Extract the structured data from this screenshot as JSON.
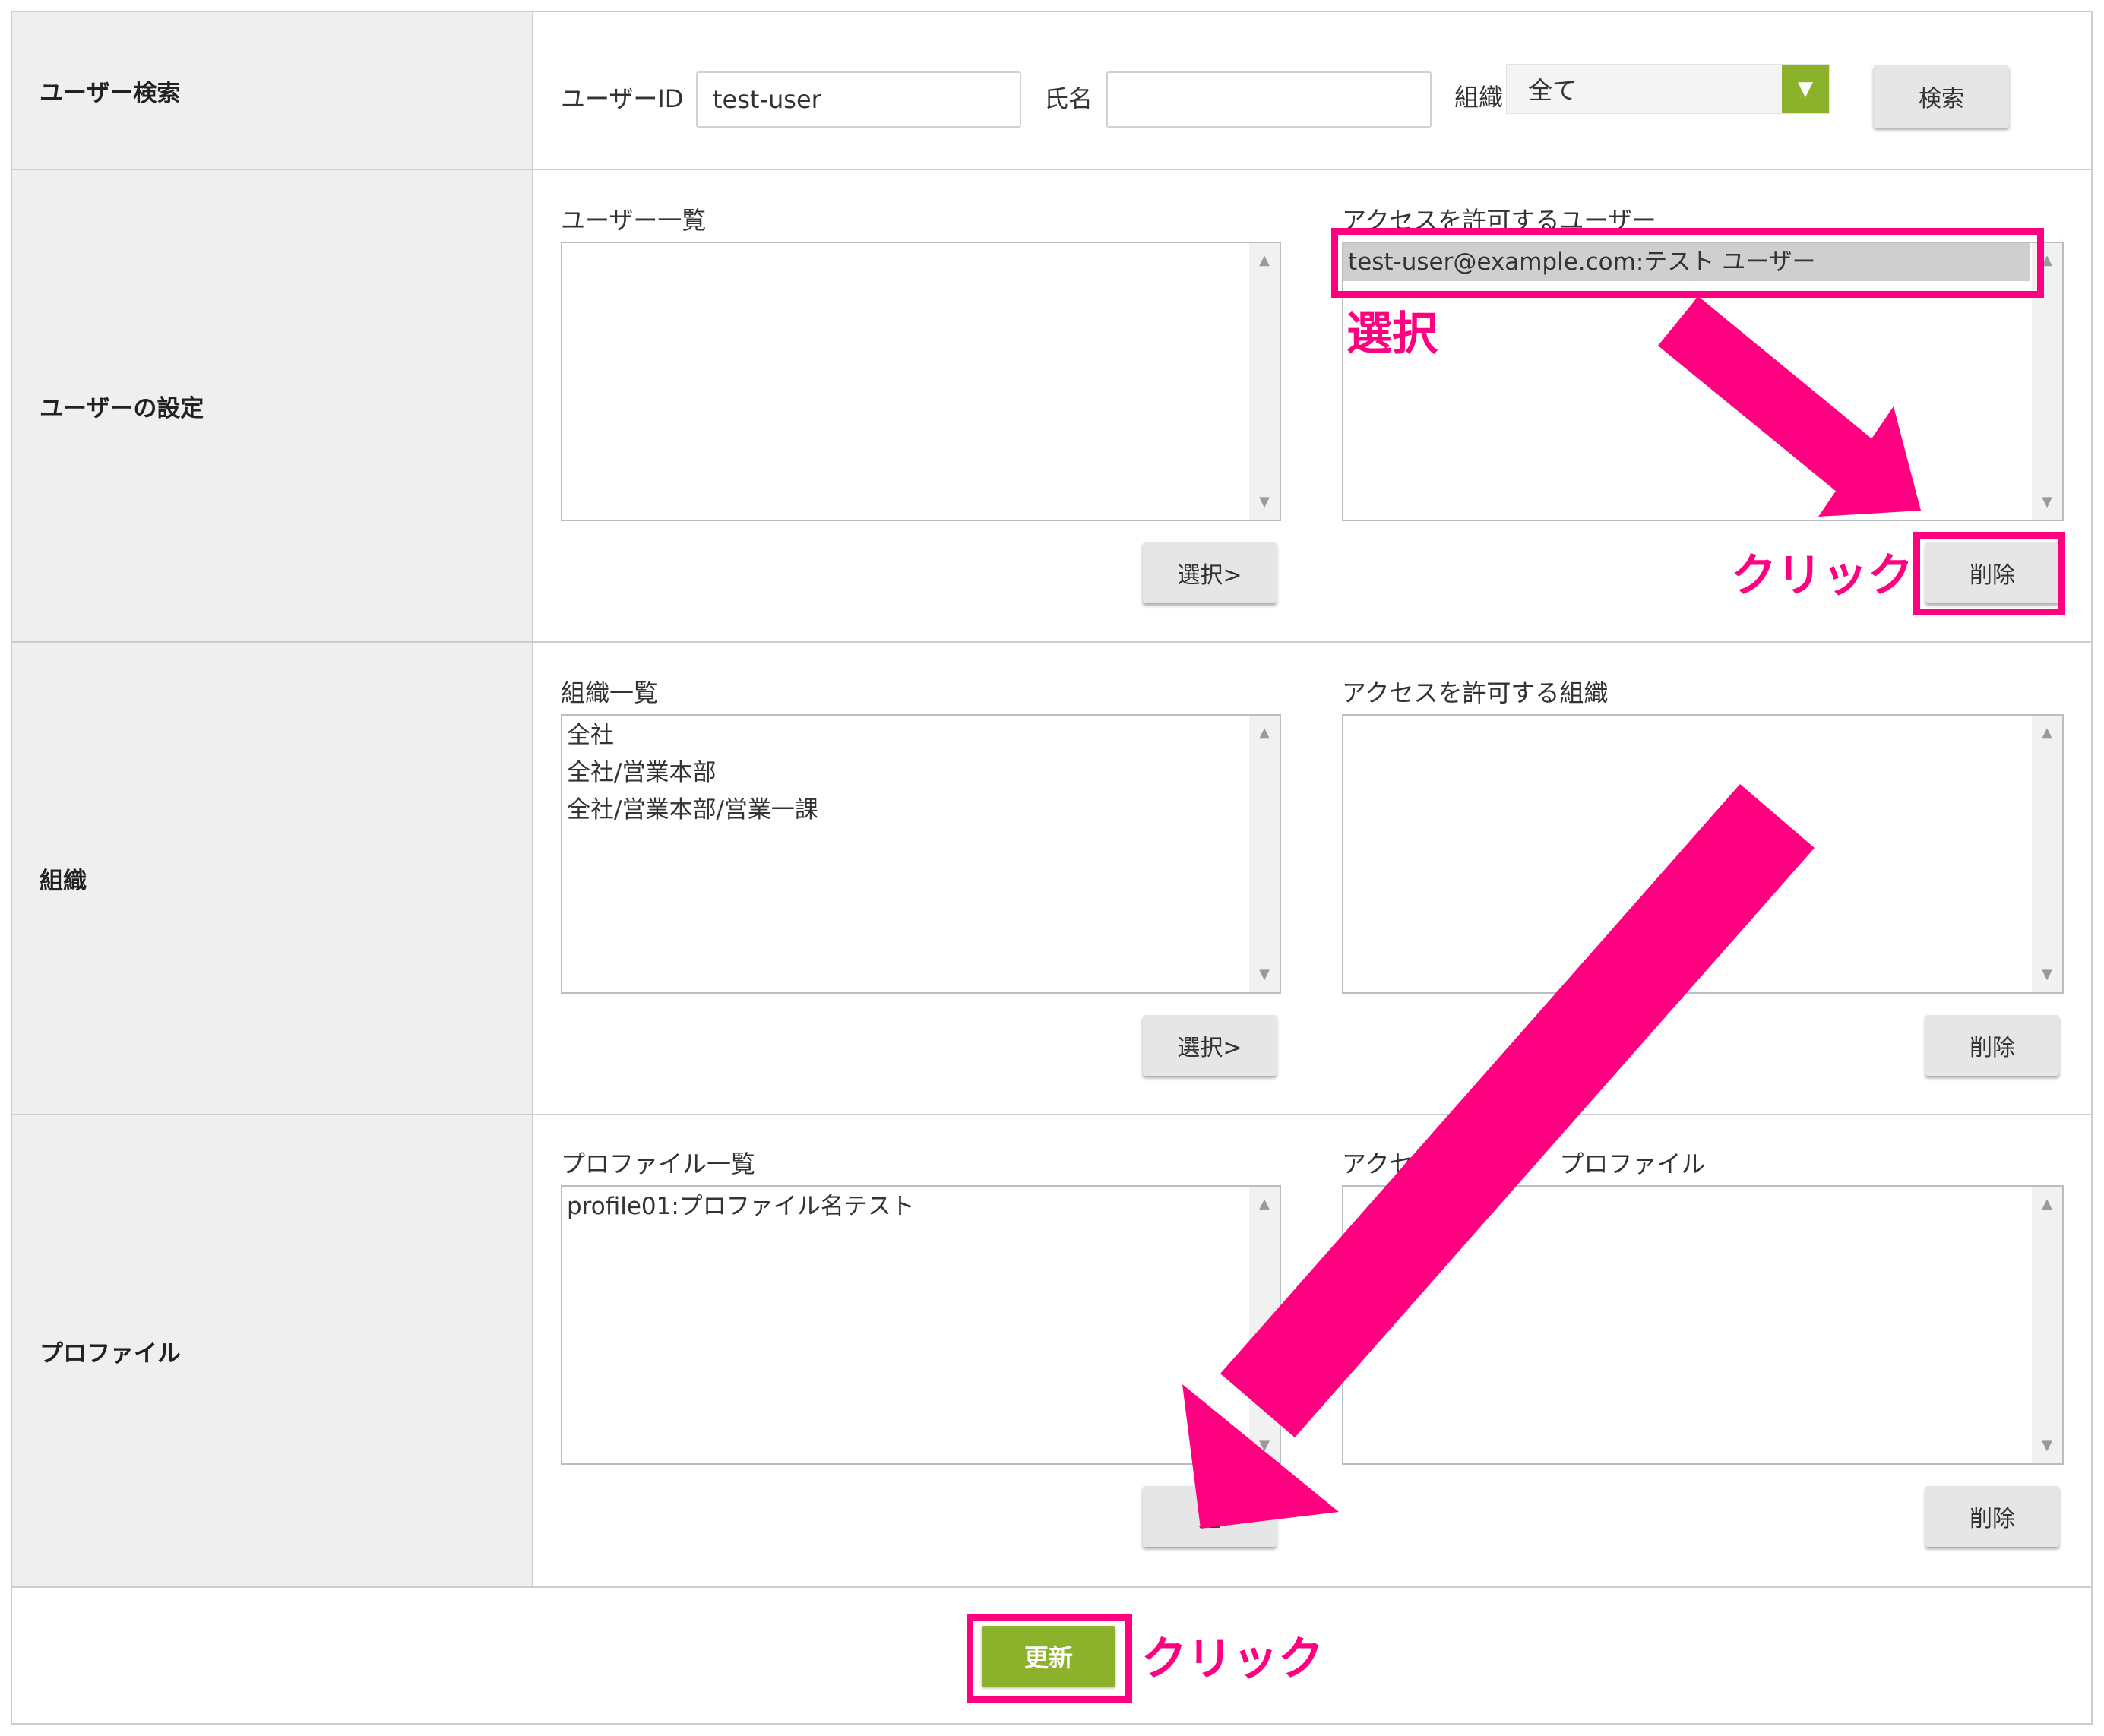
{
  "search": {
    "section_label": "ユーザー検索",
    "user_id_label": "ユーザーID",
    "user_id_value": "test-user",
    "name_label": "氏名",
    "name_value": "",
    "org_label": "組織",
    "org_selected": "全て",
    "search_button": "検索"
  },
  "user_settings": {
    "section_label": "ユーザーの設定",
    "list_title": "ユーザー一覧",
    "list_items": [],
    "allowed_title": "アクセスを許可するユーザー",
    "allowed_items": [
      "test-user@example.com:テスト ユーザー"
    ],
    "select_button": "選択>",
    "delete_button": "削除"
  },
  "org": {
    "section_label": "組織",
    "list_title": "組織一覧",
    "list_items": [
      "全社",
      "全社/営業本部",
      "全社/営業本部/営業一課"
    ],
    "allowed_title": "アクセスを許可する組織",
    "allowed_items": [],
    "select_button": "選択>",
    "delete_button": "削除"
  },
  "profile": {
    "section_label": "プロファイル",
    "list_title": "プロファイル一覧",
    "list_items": [
      "profile01:プロファイル名テスト"
    ],
    "allowed_title": "アクセス　　　　　プロファイル",
    "allowed_items": [],
    "select_button": "選",
    "delete_button": "削除"
  },
  "footer": {
    "update_button": "更新"
  },
  "annotations": {
    "select_note": "選択",
    "click_note_1": "クリック",
    "click_note_2": "クリック",
    "color": "#ff0080"
  },
  "colors": {
    "accent_green": "#8cb12a",
    "label_bg": "#efefef",
    "highlight": "#ff0080"
  }
}
